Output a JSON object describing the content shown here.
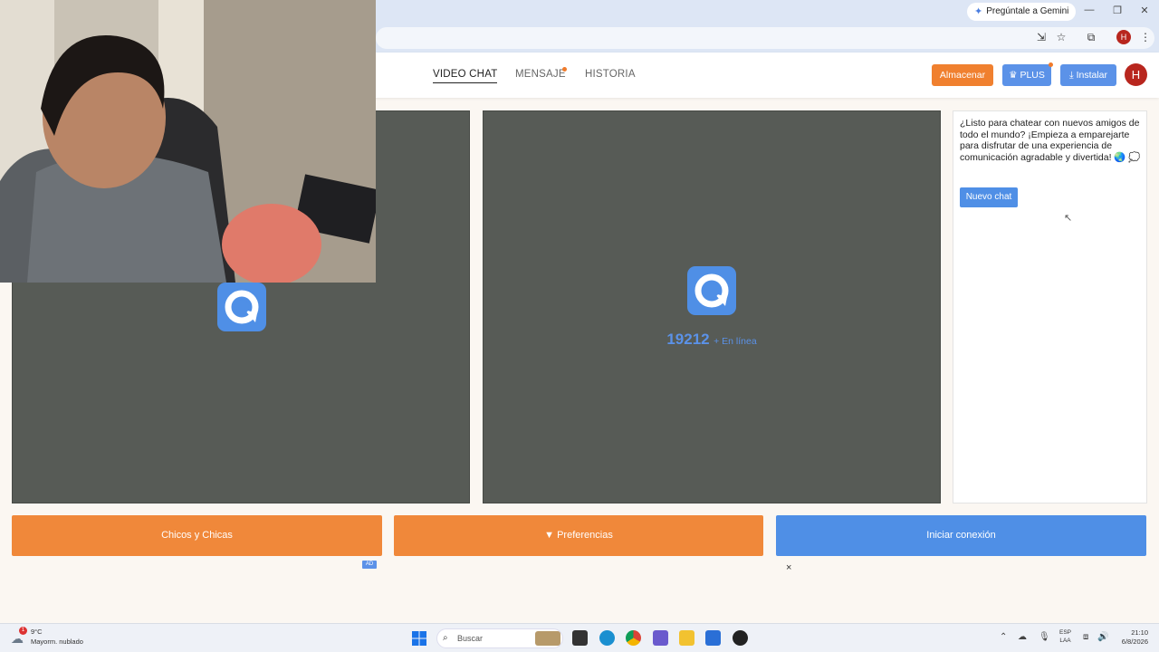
{
  "browser": {
    "gemini_label": "Pregúntale a Gemini",
    "profile_initial": "H"
  },
  "header": {
    "nav": [
      {
        "label": "VIDEO CHAT",
        "active": true
      },
      {
        "label": "MENSAJE",
        "active": false
      },
      {
        "label": "HISTORIA",
        "active": false
      }
    ],
    "store_label": "Almacenar",
    "plus_label": "PLUS",
    "install_label": "Instalar",
    "avatar_initial": "H"
  },
  "video": {
    "online_count": "19212",
    "online_label": "+ En línea"
  },
  "chat": {
    "welcome_message": "¿Listo para chatear con nuevos amigos de todo el mundo? ¡Empieza a emparejarte para disfrutar de una experiencia de comunicación agradable y divertida! 🌏 💭",
    "new_chat_label": "Nuevo chat"
  },
  "actions": {
    "gender_label": "Chicos y Chicas",
    "preferences_label": "Preferencias",
    "start_label": "Iniciar conexión",
    "ad_label": "AD",
    "close_label": "×"
  },
  "taskbar": {
    "weather_temp": "9°C",
    "weather_desc": "Mayorm. nublado",
    "weather_badge": "1",
    "search_placeholder": "Buscar",
    "lang_line1": "ESP",
    "lang_line2": "LAA",
    "time": "21:10",
    "date": "6/8/2026"
  },
  "colors": {
    "accent_orange": "#f0883a",
    "accent_blue": "#4f8fe6",
    "panel_gray": "#575b56"
  }
}
